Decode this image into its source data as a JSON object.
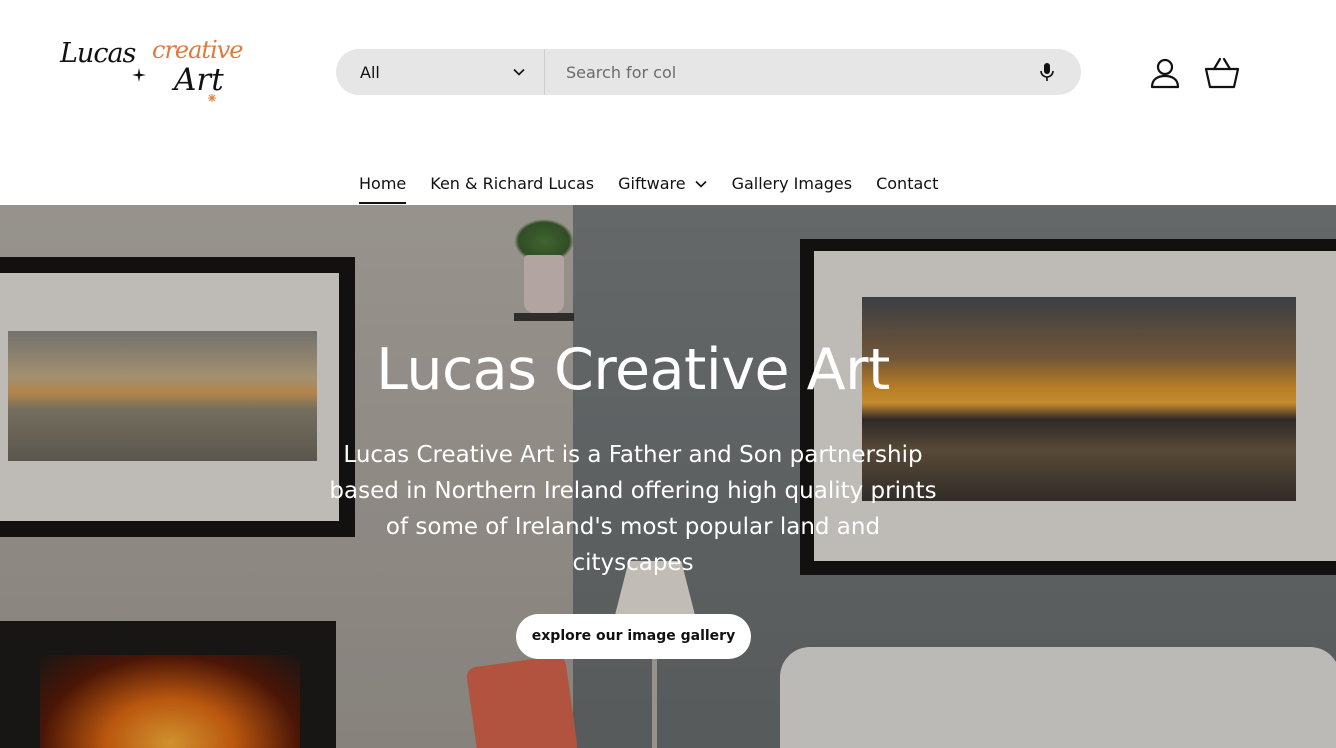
{
  "brand": {
    "logo_script_1": "Lucas",
    "logo_script_2": "creative",
    "logo_script_3": "Art"
  },
  "search": {
    "category_selected": "All",
    "placeholder": "Search for col"
  },
  "header_icons": [
    "account-icon",
    "basket-icon",
    "microphone-icon"
  ],
  "nav": {
    "items": [
      {
        "label": "Home"
      },
      {
        "label": "Ken & Richard Lucas"
      },
      {
        "label": "Giftware"
      },
      {
        "label": "Gallery Images"
      },
      {
        "label": "Contact"
      }
    ],
    "active": "Home"
  },
  "hero": {
    "title": "Lucas Creative Art",
    "text": "Lucas Creative Art is a Father and Son partnership based in Northern Ireland offering high quality prints of some of Ireland's most popular land and cityscapes",
    "button_label": "explore our image gallery"
  },
  "colors": {
    "accent": "#e07a3a",
    "search_bg": "#e6e6e6",
    "text": "#111111"
  }
}
